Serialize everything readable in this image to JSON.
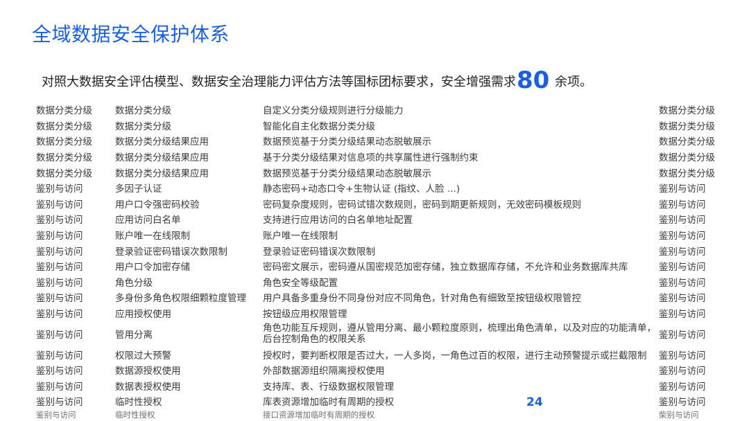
{
  "title": "全域数据安全保护体系",
  "subtitle": {
    "before": "对照大数据安全评估模型、数据安全治理能力评估方法等国标团标要求，安全增强需求",
    "number": "80",
    "after": " 余项。"
  },
  "rows": [
    [
      "数据分类分级",
      "数据分类分级",
      "自定义分类分级规则进行分级能力",
      "数据分类分级"
    ],
    [
      "数据分类分级",
      "数据分类分级",
      "智能化自主化数据分类分级",
      "数据分类分级"
    ],
    [
      "数据分类分级",
      "数据分类分级结果应用",
      "数据预览基于分类分级结果动态脱敏展示",
      "数据分类分级"
    ],
    [
      "数据分类分级",
      "数据分类分级结果应用",
      "基于分类分级结果对信息项的共享属性进行强制约束",
      "数据分类分级"
    ],
    [
      "数据分类分级",
      "数据分类分级结果应用",
      "数据预览基于分类分级结果动态脱敏展示",
      "数据分类分级"
    ],
    [
      "鉴别与访问",
      "多因子认证",
      "静态密码+动态口令+生物认证 (指纹、人脸 ...)",
      "鉴别与访问"
    ],
    [
      "鉴别与访问",
      "用户口令强密码校验",
      "密码复杂度规则，密码试错次数规则，密码到期更新规则，无效密码模板规则",
      "鉴别与访问"
    ],
    [
      "鉴别与访问",
      "应用访问白名单",
      "支持进行应用访问的白名单地址配置",
      "鉴别与访问"
    ],
    [
      "鉴别与访问",
      "账户唯一在线限制",
      "账户唯一在线限制",
      "鉴别与访问"
    ],
    [
      "鉴别与访问",
      "登录验证密码错误次数限制",
      "登录验证密码错误次数限制",
      "鉴别与访问"
    ],
    [
      "鉴别与访问",
      "用户口令加密存储",
      "密码密文展示，密码遵从国密规范加密存储，独立数据库存储，不允许和业务数据库共库",
      "鉴别与访问"
    ],
    [
      "鉴别与访问",
      "角色分级",
      "角色安全等级配置",
      "鉴别与访问"
    ],
    [
      "鉴别与访问",
      "多身份多角色权限细颗粒度管理",
      "用户具备多重身份不同身份对应不同角色，针对角色有细致至按钮级权限管控",
      "鉴别与访问"
    ],
    [
      "鉴别与访问",
      "应用授权使用",
      "按钮级应用权限管理",
      "鉴别与访问"
    ],
    [
      "鉴别与访问",
      "管用分离",
      "角色功能互斥规则，遵从管用分离、最小颗粒度原则，梳理出角色清单，以及对应的功能清单，后台控制角色的权限关系",
      "鉴别与访问"
    ],
    [
      "鉴别与访问",
      "权限过大预警",
      "授权时，要判断权限是否过大，一人多岗，一角色过百的权限，进行主动预警提示或拦截限制",
      "鉴别与访问"
    ],
    [
      "鉴别与访问",
      "数据源授权使用",
      "外部数据源组织隔离授权使用",
      "鉴别与访问"
    ],
    [
      "鉴别与访问",
      "数据表授权使用",
      "支持库、表、行级数据权限管理",
      "鉴别与访问"
    ],
    [
      "鉴别与访问",
      "临时性授权",
      "库表资源增加临时有周期的授权",
      "鉴别与访问"
    ],
    [
      "鉴别与访问",
      "临时性授权",
      "接口资源增加临时有周期的授权",
      "柴别与访问"
    ]
  ],
  "page_number": "24"
}
